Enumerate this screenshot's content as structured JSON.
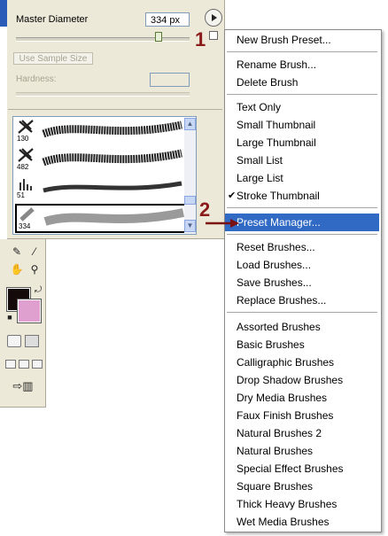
{
  "window": {
    "accent": "#2a5bb8"
  },
  "brush_panel": {
    "master_diameter_label": "Master Diameter",
    "master_diameter_value": "334 px",
    "use_sample_size_label": "Use Sample Size",
    "hardness_label": "Hardness:",
    "brushes": [
      {
        "size": "130"
      },
      {
        "size": "482"
      },
      {
        "size": "51"
      },
      {
        "size": "334",
        "selected": true
      }
    ]
  },
  "annotations": {
    "step1": "1",
    "step2": "2",
    "color": "#8b1a1a"
  },
  "toolbox": {
    "foreground_color": "#140a0a",
    "background_color": "#e0a0cf"
  },
  "menu": {
    "groups": [
      [
        {
          "label": "New Brush Preset..."
        }
      ],
      [
        {
          "label": "Rename Brush..."
        },
        {
          "label": "Delete Brush"
        }
      ],
      [
        {
          "label": "Text Only"
        },
        {
          "label": "Small Thumbnail"
        },
        {
          "label": "Large Thumbnail"
        },
        {
          "label": "Small List"
        },
        {
          "label": "Large List"
        },
        {
          "label": "Stroke Thumbnail",
          "checked": true
        }
      ],
      [
        {
          "label": "Preset Manager...",
          "highlighted": true
        }
      ],
      [
        {
          "label": "Reset Brushes..."
        },
        {
          "label": "Load Brushes..."
        },
        {
          "label": "Save Brushes..."
        },
        {
          "label": "Replace Brushes..."
        }
      ],
      [
        {
          "label": "Assorted Brushes"
        },
        {
          "label": "Basic Brushes"
        },
        {
          "label": "Calligraphic Brushes"
        },
        {
          "label": "Drop Shadow Brushes"
        },
        {
          "label": "Dry Media Brushes"
        },
        {
          "label": "Faux Finish Brushes"
        },
        {
          "label": "Natural Brushes 2"
        },
        {
          "label": "Natural Brushes"
        },
        {
          "label": "Special Effect Brushes"
        },
        {
          "label": "Square Brushes"
        },
        {
          "label": "Thick Heavy Brushes"
        },
        {
          "label": "Wet Media Brushes"
        }
      ]
    ],
    "highlight_color": "#316ac5"
  }
}
